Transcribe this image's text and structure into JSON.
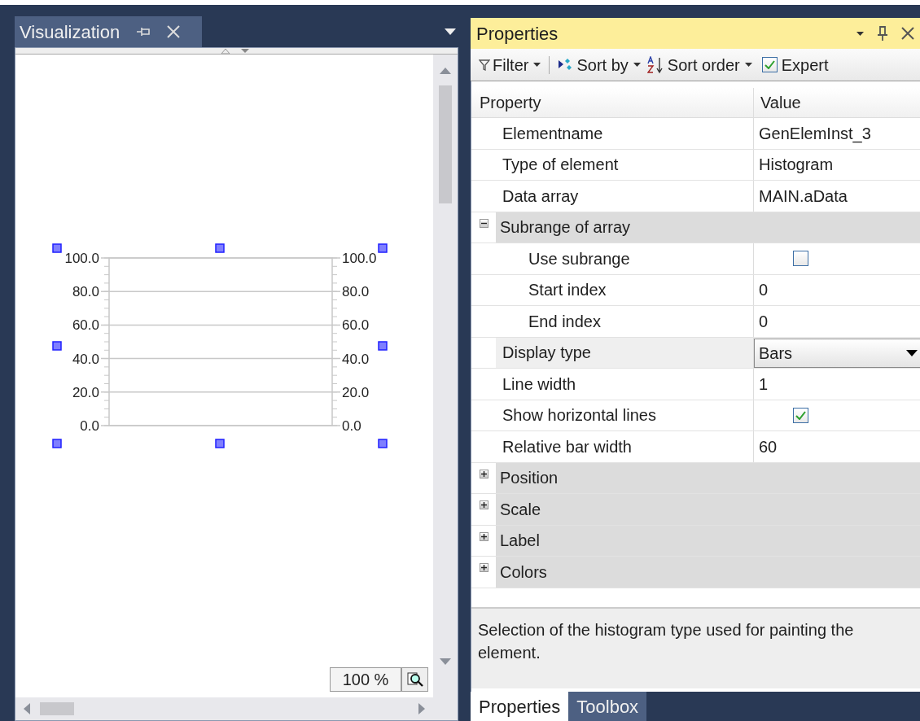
{
  "left_panel": {
    "tab": {
      "label": "Visualization",
      "selected": true
    },
    "zoom": {
      "value": "100 %"
    },
    "histogram": {
      "left_axis_labels": [
        "100.0",
        "80.0",
        "60.0",
        "40.0",
        "20.0",
        "0.0"
      ],
      "right_axis_labels": [
        "100.0",
        "80.0",
        "60.0",
        "40.0",
        "20.0",
        "0.0"
      ]
    }
  },
  "properties_panel": {
    "title": "Properties",
    "toolbar": [
      {
        "kind": "filter",
        "label": "Filter"
      },
      {
        "kind": "sortby",
        "label": "Sort by"
      },
      {
        "kind": "sortorder",
        "label": "Sort order"
      },
      {
        "kind": "expert",
        "label": "Expert",
        "checked": true
      }
    ],
    "columns": [
      "Property",
      "Value"
    ],
    "rows": [
      {
        "kind": "text",
        "label": "Elementname",
        "value": "GenElemInst_3",
        "selected": false
      },
      {
        "kind": "text",
        "label": "Type of element",
        "value": "Histogram",
        "selected": false
      },
      {
        "kind": "text",
        "label": "Data array",
        "value": "MAIN.aData",
        "selected": false
      },
      {
        "kind": "group",
        "label": "Subrange of array",
        "expanded": true,
        "children": [
          {
            "kind": "checkbox",
            "label": "Use subrange",
            "checked": false,
            "selected": false
          },
          {
            "kind": "text",
            "label": "Start index",
            "value": "0",
            "selected": false
          },
          {
            "kind": "text",
            "label": "End index",
            "value": "0",
            "selected": false
          }
        ]
      },
      {
        "kind": "dropdown",
        "label": "Display type",
        "value": "Bars",
        "selected": true
      },
      {
        "kind": "text",
        "label": "Line width",
        "value": "1",
        "selected": false
      },
      {
        "kind": "checkbox",
        "label": "Show horizontal lines",
        "checked": true,
        "selected": false
      },
      {
        "kind": "text",
        "label": "Relative bar width",
        "value": "60",
        "selected": false
      },
      {
        "kind": "group",
        "label": "Position",
        "expanded": false
      },
      {
        "kind": "group",
        "label": "Scale",
        "expanded": false
      },
      {
        "kind": "group",
        "label": "Label",
        "expanded": false
      },
      {
        "kind": "group",
        "label": "Colors",
        "expanded": false
      }
    ],
    "description": "Selection of the histogram type used for painting the element.",
    "bottom_tabs": [
      {
        "label": "Properties",
        "selected": true
      },
      {
        "label": "Toolbox",
        "selected": false
      }
    ]
  }
}
